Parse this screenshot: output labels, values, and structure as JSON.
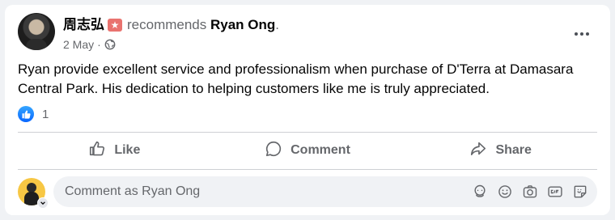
{
  "post": {
    "author": "周志弘",
    "badge_glyph": "★",
    "verb": "recommends",
    "target": "Ryan Ong",
    "target_suffix": ".",
    "date": "2 May",
    "separator": "·",
    "text": "Ryan provide excellent service and professionalism when purchase of D'Terra at Damasara Central Park. His dedication to helping customers like me is truly appreciated.",
    "reaction_count": "1"
  },
  "actions": {
    "like": "Like",
    "comment": "Comment",
    "share": "Share"
  },
  "composer": {
    "placeholder": "Comment as Ryan Ong"
  },
  "colors": {
    "accent": "#0866ff",
    "secondary_text": "#65676b",
    "badge": "#e9736f"
  },
  "icons": [
    "globe-icon",
    "more-icon",
    "like-reaction-icon",
    "like-icon",
    "comment-icon",
    "share-icon",
    "avatar-sticker-icon",
    "emoji-icon",
    "camera-icon",
    "gif-icon",
    "sticker-icon"
  ]
}
